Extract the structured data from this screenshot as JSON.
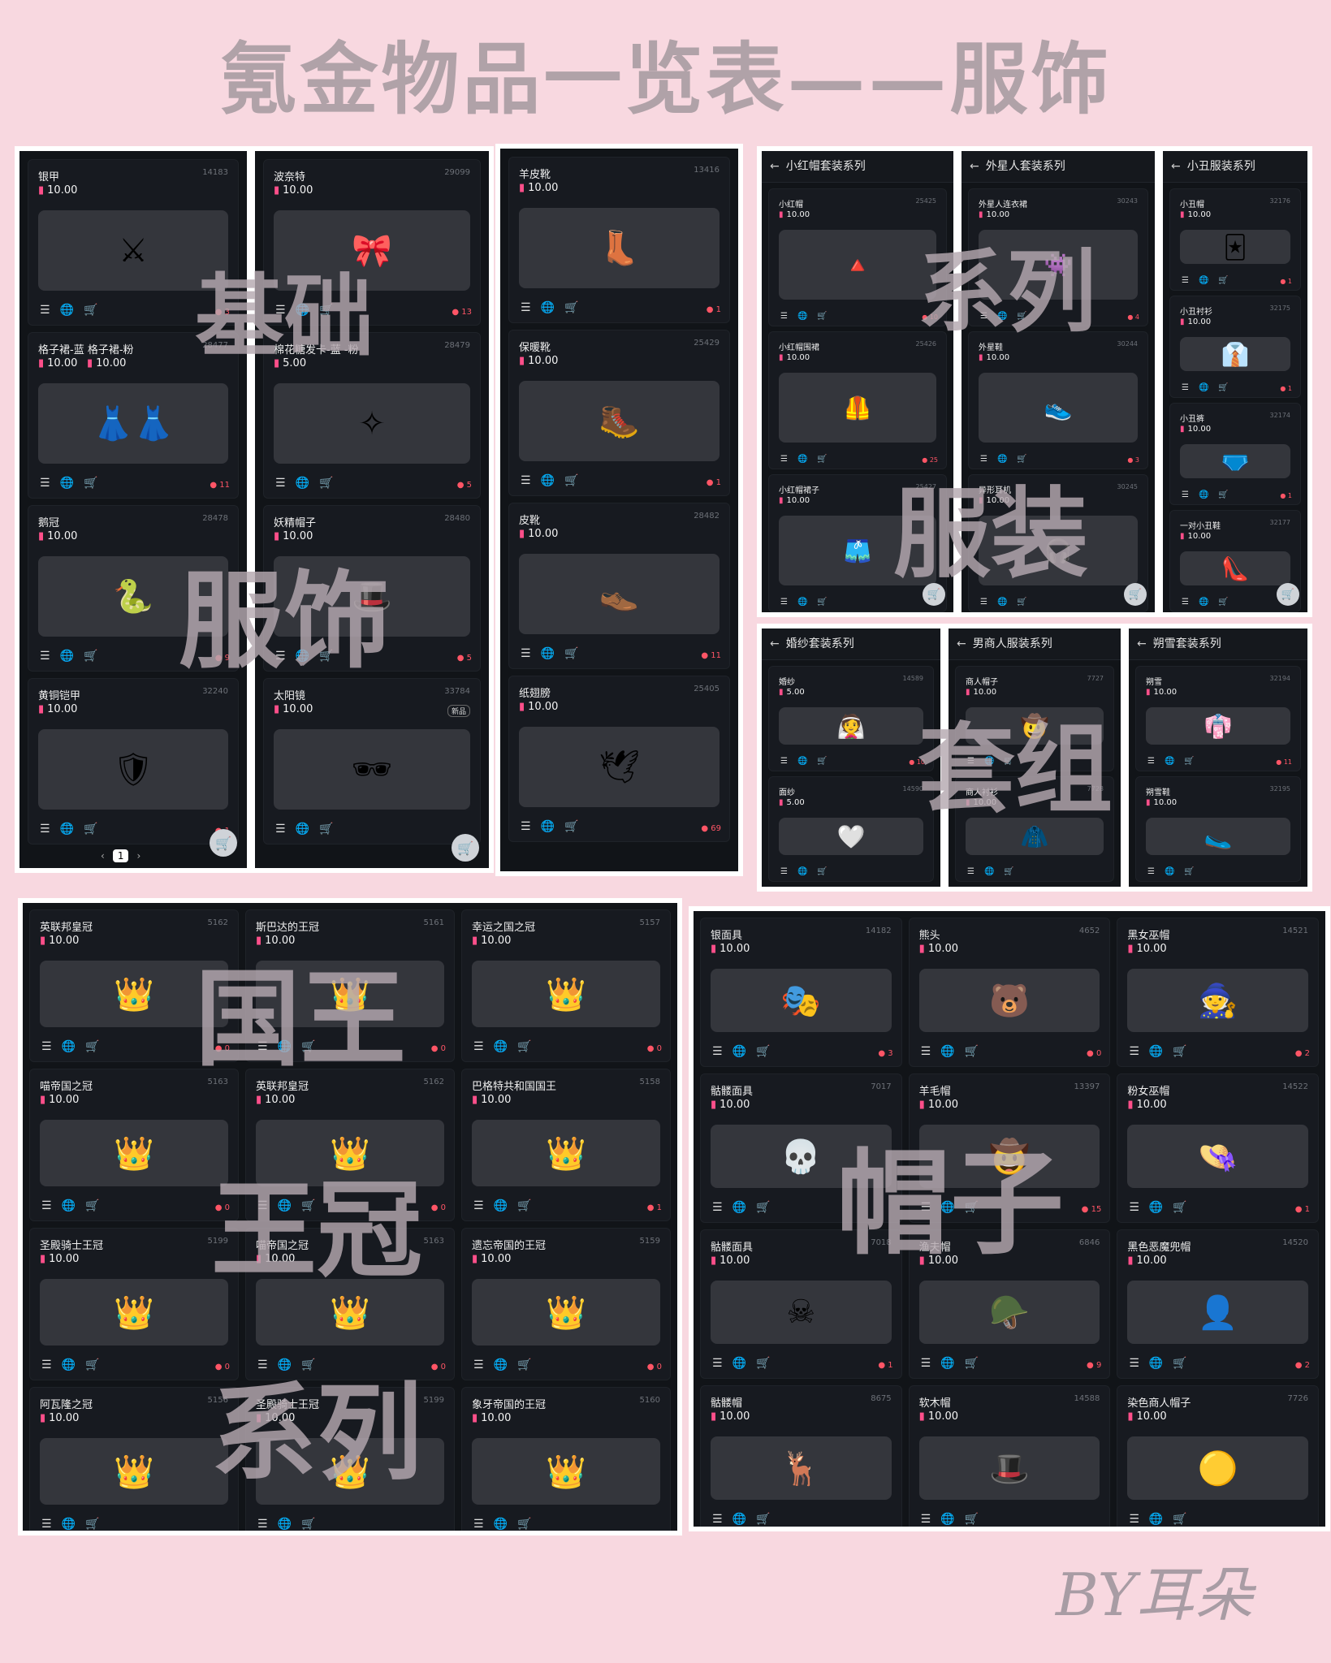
{
  "title": "氪金物品一览表——服饰",
  "signature": "BY耳朵",
  "icons": {
    "list": "☰",
    "globe": "🌐",
    "cart": "🛒",
    "gem": "▮",
    "back": "←",
    "drop": "●"
  },
  "watermarks": [
    "基础",
    "系列",
    "服饰",
    "服装",
    "套组",
    "国王",
    "王冠",
    "系列",
    "帽子"
  ],
  "col1": [
    {
      "name": "银甲",
      "id": "14183",
      "price": "10.00",
      "count": "3",
      "icon": "⚔"
    },
    {
      "name": "格子裙-蓝 格子裙-粉",
      "id": "28477",
      "price": "10.00",
      "price2": "10.00",
      "count": "11",
      "icon": "👗👗"
    },
    {
      "name": "鹅冠",
      "id": "28478",
      "price": "10.00",
      "count": "9",
      "icon": "🐍"
    },
    {
      "name": "黄铜铠甲",
      "id": "32240",
      "price": "10.00",
      "count": "1",
      "icon": "🛡"
    }
  ],
  "pager": {
    "prev": "‹",
    "page": "1",
    "next": "›"
  },
  "col2": [
    {
      "name": "波奈特",
      "id": "29099",
      "price": "10.00",
      "count": "13",
      "icon": "🎀"
    },
    {
      "name": "棉花糖发卡-蓝 -粉",
      "id": "28479",
      "price": "5.00",
      "count": "5",
      "icon": "✧"
    },
    {
      "name": "妖精帽子",
      "id": "28480",
      "price": "10.00",
      "count": "5",
      "icon": "🎩"
    },
    {
      "name": "太阳镜",
      "id": "33784",
      "price": "10.00",
      "count": "",
      "badge": "新品",
      "icon": "🕶"
    }
  ],
  "col3": [
    {
      "name": "羊皮靴",
      "id": "13416",
      "price": "10.00",
      "count": "1",
      "icon": "👢"
    },
    {
      "name": "保暖靴",
      "id": "25429",
      "price": "10.00",
      "count": "1",
      "icon": "🥾"
    },
    {
      "name": "皮靴",
      "id": "28482",
      "price": "10.00",
      "count": "11",
      "icon": "👞"
    },
    {
      "name": "纸翅膀",
      "id": "25405",
      "price": "10.00",
      "count": "69",
      "icon": "🕊"
    }
  ],
  "sets_top": [
    {
      "title": "小红帽套装系列",
      "items": [
        {
          "name": "小红帽",
          "id": "25425",
          "price": "10.00",
          "count": "10",
          "icon": "🔺"
        },
        {
          "name": "小红帽围裙",
          "id": "25426",
          "price": "10.00",
          "count": "25",
          "icon": "🦺"
        },
        {
          "name": "小红帽裙子",
          "id": "25427",
          "price": "10.00",
          "count": "",
          "icon": "🩳"
        }
      ]
    },
    {
      "title": "外星人套装系列",
      "items": [
        {
          "name": "外星人连衣裙",
          "id": "30243",
          "price": "10.00",
          "count": "4",
          "icon": "👾"
        },
        {
          "name": "外星鞋",
          "id": "30244",
          "price": "10.00",
          "count": "3",
          "icon": "👟"
        },
        {
          "name": "异形耳机",
          "id": "30245",
          "price": "10.00",
          "count": "",
          "icon": "🎧"
        }
      ]
    },
    {
      "title": "小丑服装系列",
      "items": [
        {
          "name": "小丑帽",
          "id": "32176",
          "price": "10.00",
          "count": "1",
          "icon": "🃏"
        },
        {
          "name": "小丑衬衫",
          "id": "32175",
          "price": "10.00",
          "count": "1",
          "icon": "👔"
        },
        {
          "name": "小丑裤",
          "id": "32174",
          "price": "10.00",
          "count": "1",
          "icon": "🩲"
        },
        {
          "name": "一对小丑鞋",
          "id": "32177",
          "price": "10.00",
          "count": "",
          "icon": "👠"
        }
      ]
    }
  ],
  "sets_mid": [
    {
      "title": "婚纱套装系列",
      "items": [
        {
          "name": "婚纱",
          "id": "14589",
          "price": "5.00",
          "count": "10",
          "icon": "👰"
        },
        {
          "name": "面纱",
          "id": "14590",
          "price": "5.00",
          "count": "",
          "icon": "🤍"
        }
      ]
    },
    {
      "title": "男商人服装系列",
      "items": [
        {
          "name": "商人帽子",
          "id": "7727",
          "price": "10.00",
          "count": "",
          "icon": "🤠"
        },
        {
          "name": "商人衬衫",
          "id": "7728",
          "price": "10.00",
          "count": "",
          "icon": "🧥"
        }
      ]
    },
    {
      "title": "朔雪套装系列",
      "items": [
        {
          "name": "朔雪",
          "id": "32194",
          "price": "10.00",
          "count": "11",
          "icon": "👘"
        },
        {
          "name": "朔雪鞋",
          "id": "32195",
          "price": "10.00",
          "count": "",
          "icon": "🥿"
        }
      ]
    }
  ],
  "crowns": [
    {
      "name": "英联邦皇冠",
      "id": "5162",
      "price": "10.00",
      "count": "0"
    },
    {
      "name": "斯巴达的王冠",
      "id": "5161",
      "price": "10.00",
      "count": "0"
    },
    {
      "name": "幸运之国之冠",
      "id": "5157",
      "price": "10.00",
      "count": "0"
    },
    {
      "name": "喵帝国之冠",
      "id": "5163",
      "price": "10.00",
      "count": "0"
    },
    {
      "name": "英联邦皇冠",
      "id": "5162",
      "price": "10.00",
      "count": "0"
    },
    {
      "name": "巴格特共和国国王",
      "id": "5158",
      "price": "10.00",
      "count": "1"
    },
    {
      "name": "圣殿骑士王冠",
      "id": "5199",
      "price": "10.00",
      "count": "0"
    },
    {
      "name": "喵帝国之冠",
      "id": "5163",
      "price": "10.00",
      "count": "0"
    },
    {
      "name": "遗忘帝国的王冠",
      "id": "5159",
      "price": "10.00",
      "count": "0"
    },
    {
      "name": "阿瓦隆之冠",
      "id": "5156",
      "price": "10.00",
      "count": ""
    },
    {
      "name": "圣殿骑士王冠",
      "id": "5199",
      "price": "10.00",
      "count": ""
    },
    {
      "name": "象牙帝国的王冠",
      "id": "5160",
      "price": "10.00",
      "count": ""
    }
  ],
  "hats": [
    {
      "name": "银面具",
      "id": "14182",
      "price": "10.00",
      "count": "3",
      "icon": "🎭"
    },
    {
      "name": "熊头",
      "id": "4652",
      "price": "10.00",
      "count": "0",
      "icon": "🐻"
    },
    {
      "name": "黑女巫帽",
      "id": "14521",
      "price": "10.00",
      "count": "2",
      "icon": "🧙"
    },
    {
      "name": "骷髅面具",
      "id": "7017",
      "price": "10.00",
      "count": "",
      "icon": "💀"
    },
    {
      "name": "羊毛帽",
      "id": "13397",
      "price": "10.00",
      "count": "15",
      "icon": "🤠"
    },
    {
      "name": "粉女巫帽",
      "id": "14522",
      "price": "10.00",
      "count": "1",
      "icon": "👒"
    },
    {
      "name": "骷髅面具",
      "id": "7018",
      "price": "10.00",
      "count": "1",
      "icon": "☠"
    },
    {
      "name": "渔夫帽",
      "id": "6846",
      "price": "10.00",
      "count": "9",
      "icon": "🪖"
    },
    {
      "name": "黑色恶魔兜帽",
      "id": "14520",
      "price": "10.00",
      "count": "2",
      "icon": "👤"
    },
    {
      "name": "骷髅帽",
      "id": "8675",
      "price": "10.00",
      "count": "",
      "icon": "🦌"
    },
    {
      "name": "软木帽",
      "id": "14588",
      "price": "10.00",
      "count": "",
      "icon": "🎩"
    },
    {
      "name": "染色商人帽子",
      "id": "7726",
      "price": "10.00",
      "count": "",
      "icon": "🟡"
    }
  ]
}
